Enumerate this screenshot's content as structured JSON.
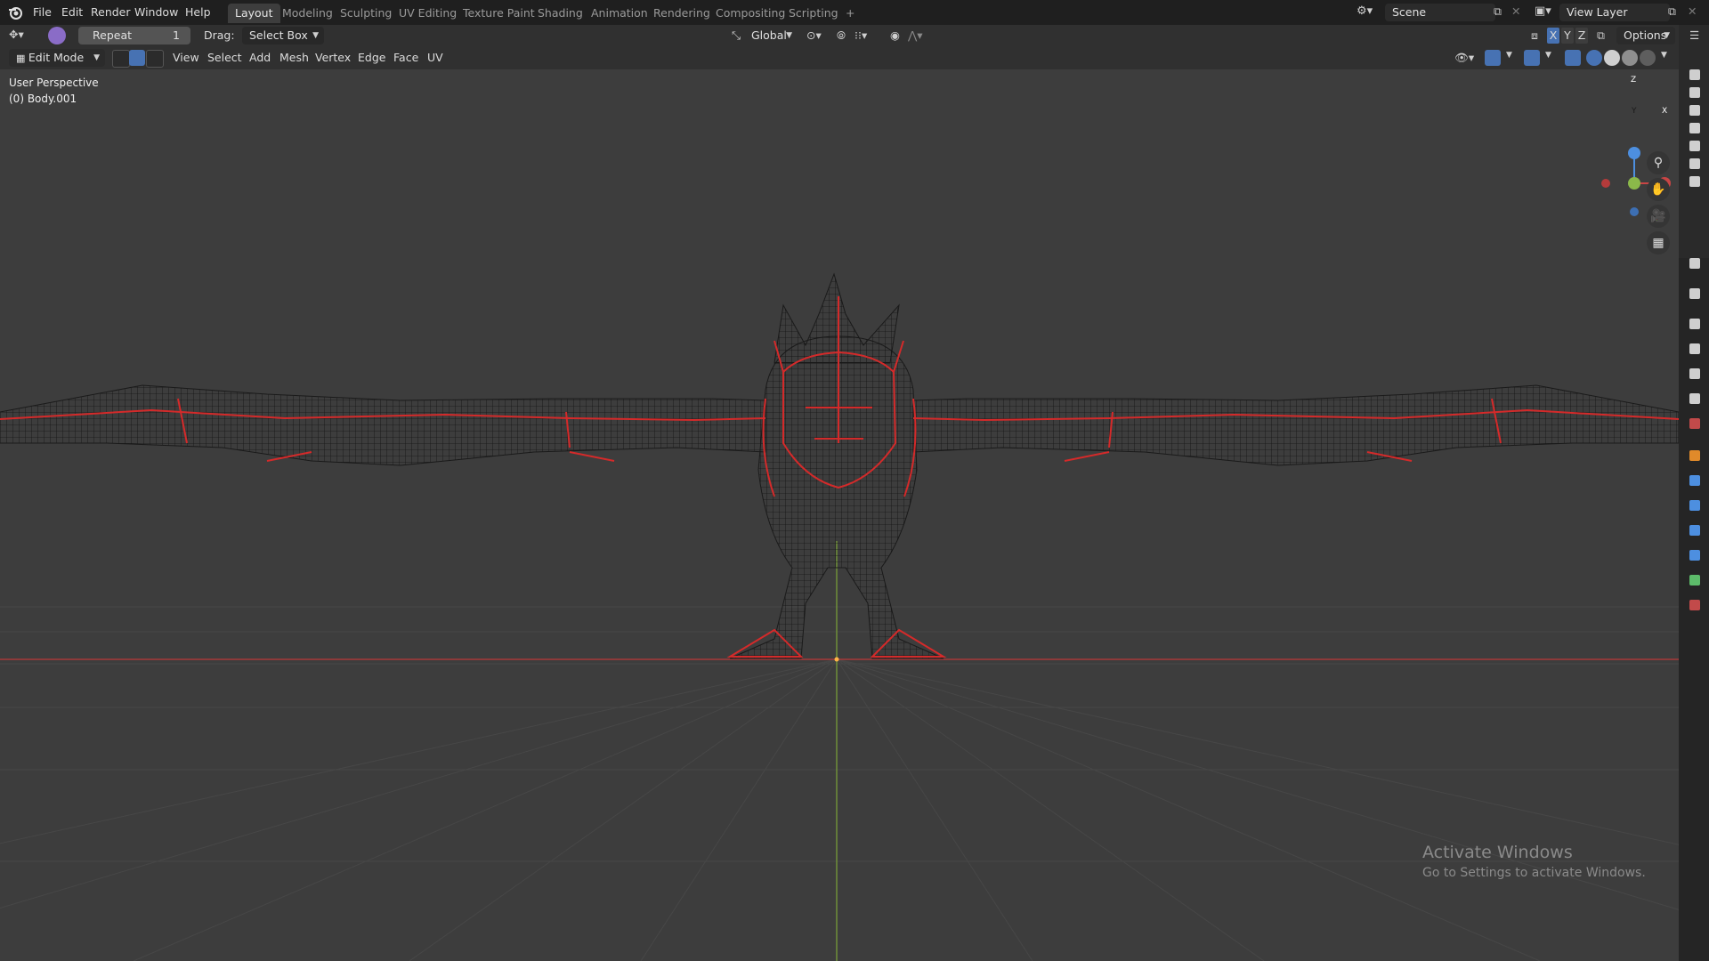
{
  "topbar": {
    "menus": [
      "File",
      "Edit",
      "Render",
      "Window",
      "Help"
    ],
    "workspaces": [
      "Layout",
      "Modeling",
      "Sculpting",
      "UV Editing",
      "Texture Paint",
      "Shading",
      "Animation",
      "Rendering",
      "Compositing",
      "Scripting"
    ],
    "active_workspace": "Layout",
    "add_tab": "+",
    "scene": "Scene",
    "view_layer": "View Layer"
  },
  "toolbar": {
    "repeat_label": "Repeat",
    "repeat_count": "1",
    "drag_label": "Drag:",
    "drag_value": "Select Box",
    "orientation": "Global",
    "axes": [
      "X",
      "Y",
      "Z"
    ],
    "options": "Options"
  },
  "header": {
    "mode": "Edit Mode",
    "menus": [
      "View",
      "Select",
      "Add",
      "Mesh",
      "Vertex",
      "Edge",
      "Face",
      "UV"
    ]
  },
  "viewport": {
    "perspective_label": "User Perspective",
    "object_label": "(0) Body.001",
    "gizmo_axes": [
      "Z",
      "Y",
      "X"
    ]
  },
  "watermark": {
    "title": "Activate Windows",
    "subtitle": "Go to Settings to activate Windows."
  },
  "colors": {
    "background": "#3d3d3d",
    "wire": "#1a1a1a",
    "edge_highlight": "#d42a2a",
    "x_axis": "#c94545",
    "y_axis": "#8bb84a",
    "z_axis": "#4d8fe0"
  }
}
